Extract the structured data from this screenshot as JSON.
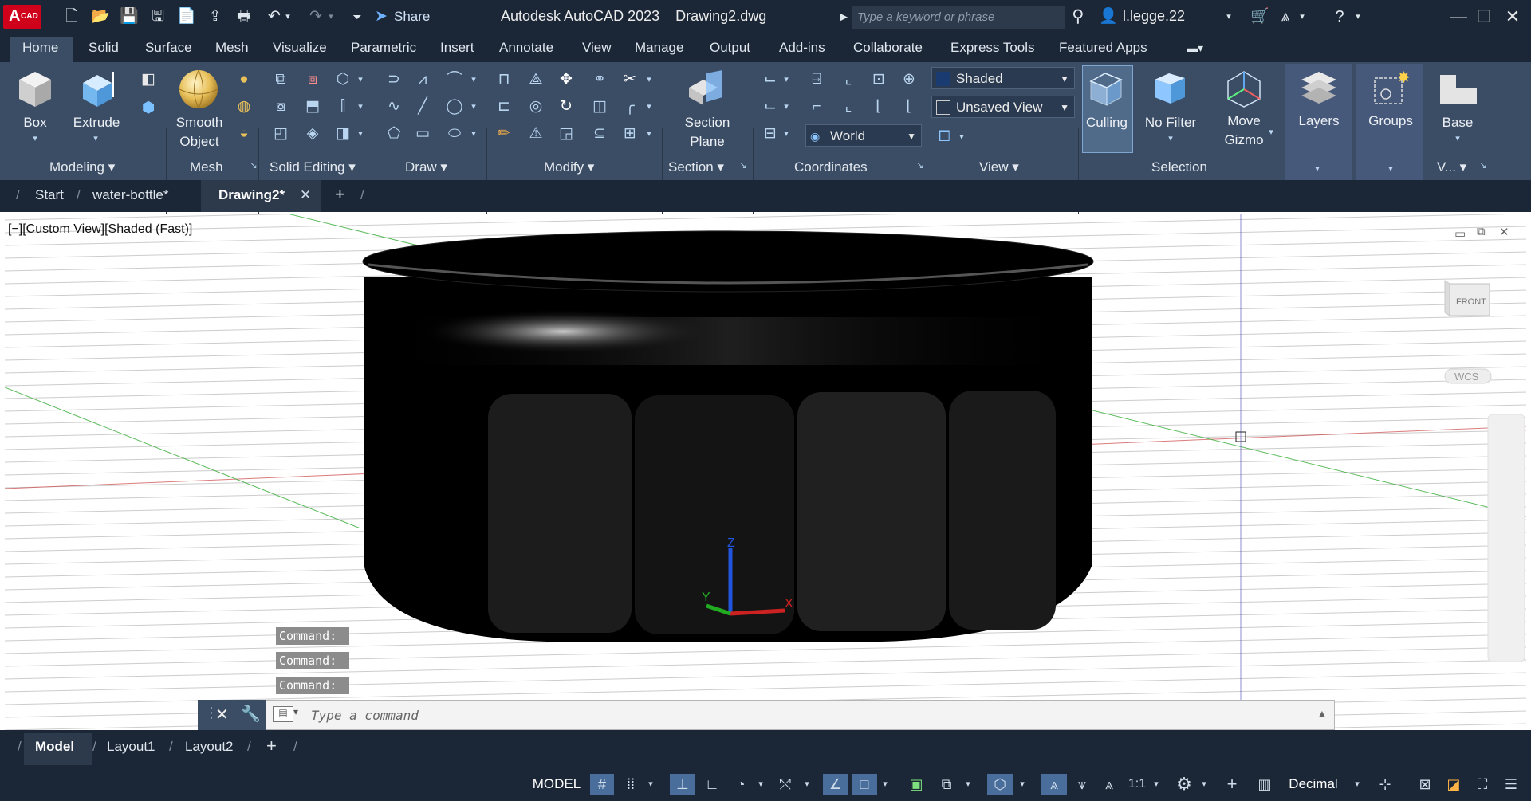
{
  "app": {
    "logo_main": "A",
    "logo_sub": "CAD",
    "title": "Autodesk AutoCAD 2023",
    "document": "Drawing2.dwg"
  },
  "quick_access": {
    "share_label": "Share"
  },
  "search": {
    "placeholder": "Type a keyword or phrase"
  },
  "user": {
    "name": "l.legge.22"
  },
  "ribbon_tabs": [
    "Home",
    "Solid",
    "Surface",
    "Mesh",
    "Visualize",
    "Parametric",
    "Insert",
    "Annotate",
    "View",
    "Manage",
    "Output",
    "Add-ins",
    "Collaborate",
    "Express Tools",
    "Featured Apps"
  ],
  "ribbon": {
    "box": "Box",
    "extrude": "Extrude",
    "smooth1": "Smooth",
    "smooth2": "Object",
    "section1": "Section",
    "section2": "Plane",
    "visual_style": "Shaded",
    "view_name": "Unsaved View",
    "ucs": "World",
    "culling": "Culling",
    "filter": "No Filter",
    "gizmo1": "Move",
    "gizmo2": "Gizmo",
    "layers": "Layers",
    "groups": "Groups",
    "base": "Base",
    "panels": {
      "modeling": "Modeling",
      "mesh": "Mesh",
      "solid_editing": "Solid Editing",
      "draw": "Draw",
      "modify": "Modify",
      "section": "Section",
      "coordinates": "Coordinates",
      "view": "View",
      "selection": "Selection",
      "view_short": "V..."
    }
  },
  "file_tabs": {
    "start": "Start",
    "water_bottle": "water-bottle*",
    "drawing2": "Drawing2*"
  },
  "viewport": {
    "label": "[−][Custom View][Shaded (Fast)]",
    "viewcube_face": "FRONT",
    "wcs": "WCS",
    "axis_x": "X",
    "axis_y": "Y",
    "axis_z": "Z"
  },
  "command_history": [
    "Command:",
    "Command:",
    "Command:"
  ],
  "command_line": {
    "placeholder": "Type a command"
  },
  "layout_tabs": {
    "model": "Model",
    "layout1": "Layout1",
    "layout2": "Layout2"
  },
  "status": {
    "model": "MODEL",
    "scale": "1:1",
    "units": "Decimal"
  },
  "colors": {
    "ribbon_bg": "#3b4d65",
    "title_bg": "#1b2736",
    "accent": "#4a6e9c",
    "axis_red": "#cc2222",
    "axis_green": "#22aa22",
    "axis_blue": "#2255dd"
  }
}
